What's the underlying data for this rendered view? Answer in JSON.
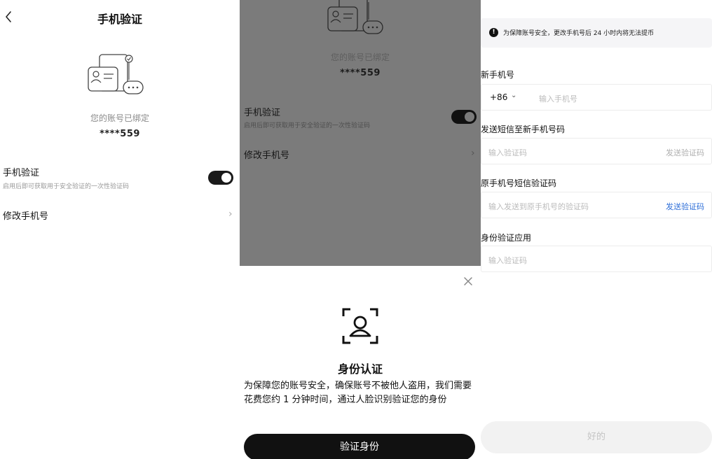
{
  "colors": {
    "primary": "#111111",
    "link_blue": "#2f6fd8",
    "link_muted": "#bbbbbb",
    "overlay": "#7b7b7b"
  },
  "panel1": {
    "back_icon": "chevron-left-icon",
    "title": "手机验证",
    "bound_text": "您的账号已绑定",
    "masked_phone": "****559",
    "sms_verify": {
      "title": "手机验证",
      "subtitle": "启用后即可获取用于安全验证的一次性验证码",
      "enabled": true
    },
    "change_phone": {
      "label": "修改手机号"
    }
  },
  "panel2": {
    "bound_text": "您的账号已绑定",
    "masked_phone": "****559",
    "sms_verify": {
      "title": "手机验证",
      "subtitle": "启用后即可获取用于安全验证的一次性验证码",
      "enabled": true
    },
    "change_phone": {
      "label": "修改手机号"
    },
    "sheet": {
      "close_icon": "close-icon",
      "face_icon": "face-scan-icon",
      "title": "身份认证",
      "description": "为保障您的账号安全，确保账号不被他人盗用，我们需要花费您约 1 分钟时间，通过人脸识别验证您的身份",
      "button": "验证身份"
    }
  },
  "panel3": {
    "notice": "为保障账号安全，更改手机号后 24 小时内将无法提币",
    "new_phone": {
      "label": "新手机号",
      "country_code": "+86",
      "placeholder": "输入手机号"
    },
    "new_sms": {
      "label": "发送短信至新手机号码",
      "placeholder": "输入验证码",
      "send": "发送验证码"
    },
    "old_sms": {
      "label": "原手机号短信验证码",
      "placeholder": "输入发送到原手机号的验证码",
      "send": "发送验证码"
    },
    "authenticator": {
      "label": "身份验证应用",
      "placeholder": "输入验证码"
    },
    "ok_button": "好的"
  }
}
